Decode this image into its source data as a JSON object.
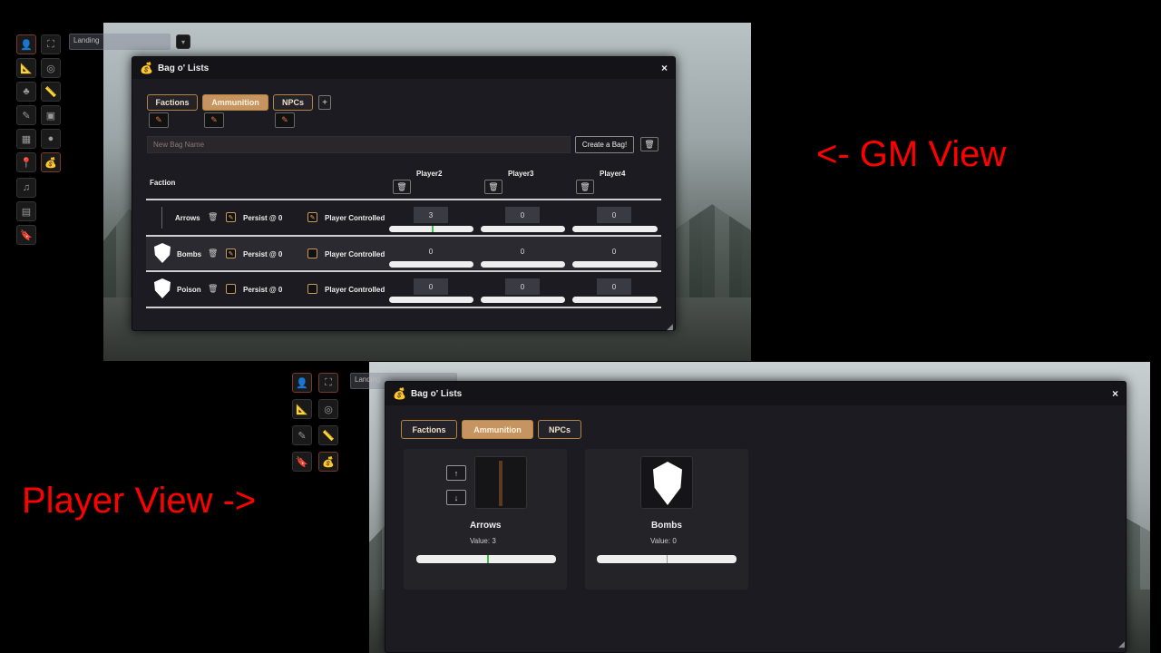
{
  "annotations": {
    "gm_view": "<- GM View",
    "player_view": "Player View ->"
  },
  "gm": {
    "scene_nav_label": "Landing",
    "window_title": "Bag o' Lists",
    "close_icon": "×",
    "tabs": [
      {
        "label": "Factions",
        "selected": false
      },
      {
        "label": "Ammunition",
        "selected": true
      },
      {
        "label": "NPCs",
        "selected": false
      }
    ],
    "add_tab_label": "+",
    "new_bag_placeholder": "New Bag Name",
    "create_bag_label": "Create a Bag!",
    "table": {
      "first_header": "Faction",
      "players": [
        "Player2",
        "Player3",
        "Player4"
      ],
      "rows": [
        {
          "name": "Arrows",
          "persist_label": "Persist @ 0",
          "persist_checked": true,
          "player_controlled_label": "Player Controlled",
          "player_controlled_checked": true,
          "values": [
            "3",
            "0",
            "0"
          ],
          "fills": [
            0.5,
            0.0,
            0.0
          ],
          "has_icon": false
        },
        {
          "name": "Bombs",
          "persist_label": "Persist @ 0",
          "persist_checked": true,
          "player_controlled_label": "Player Controlled",
          "player_controlled_checked": false,
          "values": [
            "0",
            "0",
            "0"
          ],
          "fills": [
            0.0,
            0.0,
            0.0
          ],
          "has_icon": true
        },
        {
          "name": "Poison",
          "persist_label": "Persist @ 0",
          "persist_checked": false,
          "player_controlled_label": "Player Controlled",
          "player_controlled_checked": false,
          "values": [
            "0",
            "0",
            "0"
          ],
          "fills": [
            0.0,
            0.0,
            0.0
          ],
          "has_icon": true
        }
      ]
    }
  },
  "player": {
    "scene_nav_label": "Landing",
    "window_title": "Bag o' Lists",
    "close_icon": "×",
    "tabs": [
      {
        "label": "Factions",
        "selected": false
      },
      {
        "label": "Ammunition",
        "selected": true
      },
      {
        "label": "NPCs",
        "selected": false
      }
    ],
    "cards": [
      {
        "name": "Arrows",
        "value_label": "Value: 3",
        "fill": 0.5
      },
      {
        "name": "Bombs",
        "value_label": "Value: 0",
        "fill": 0.5
      }
    ],
    "up_icon": "↑",
    "down_icon": "↓"
  },
  "icons": {
    "trash": "🗑",
    "edit": "✎",
    "check": "✎"
  },
  "colors": {
    "accent": "#c69461",
    "accent_border": "#b5833e",
    "annotation_red": "#ff0000",
    "bar_marker": "#3bbf4a"
  }
}
